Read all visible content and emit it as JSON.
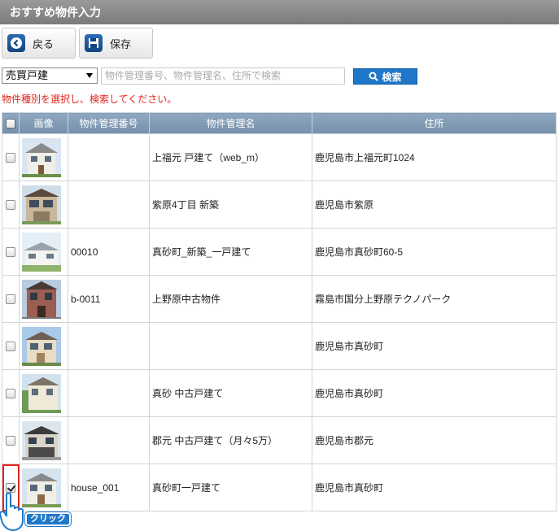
{
  "header": {
    "title": "おすすめ物件入力"
  },
  "toolbar": {
    "back_label": "戻る",
    "save_label": "保存"
  },
  "search": {
    "type_selected": "売買戸建",
    "placeholder": "物件管理番号、物件管理名、住所で検索",
    "button_label": "検索",
    "notice": "物件種別を選択し、検索してください。"
  },
  "table": {
    "headers": {
      "image": "画像",
      "code": "物件管理番号",
      "name": "物件管理名",
      "address": "住所"
    },
    "rows": [
      {
        "checked": false,
        "code": "",
        "name": "上福元 戸建て（web_m）",
        "address": "鹿児島市上福元町1024"
      },
      {
        "checked": false,
        "code": "",
        "name": "紫原4丁目 新築",
        "address": "鹿児島市紫原"
      },
      {
        "checked": false,
        "code": "00010",
        "name": "真砂町_新築_一戸建て",
        "address": "鹿児島市真砂町60-5"
      },
      {
        "checked": false,
        "code": "b-0011",
        "name": "上野原中古物件",
        "address": "霧島市国分上野原テクノパーク"
      },
      {
        "checked": false,
        "code": "",
        "name": "",
        "address": "鹿児島市真砂町"
      },
      {
        "checked": false,
        "code": "",
        "name": "真砂 中古戸建て",
        "address": "鹿児島市真砂町"
      },
      {
        "checked": false,
        "code": "",
        "name": "郡元 中古戸建て（月々5万）",
        "address": "鹿児島市郡元"
      },
      {
        "checked": true,
        "code": "house_001",
        "name": "真砂町一戸建て",
        "address": "鹿児島市真砂町"
      }
    ]
  },
  "annotation": {
    "click_label": "クリック"
  },
  "colors": {
    "header_bar": "#888888",
    "table_header": "#7f98b2",
    "accent_blue": "#1f77c9",
    "alert_red": "#e0261b"
  }
}
